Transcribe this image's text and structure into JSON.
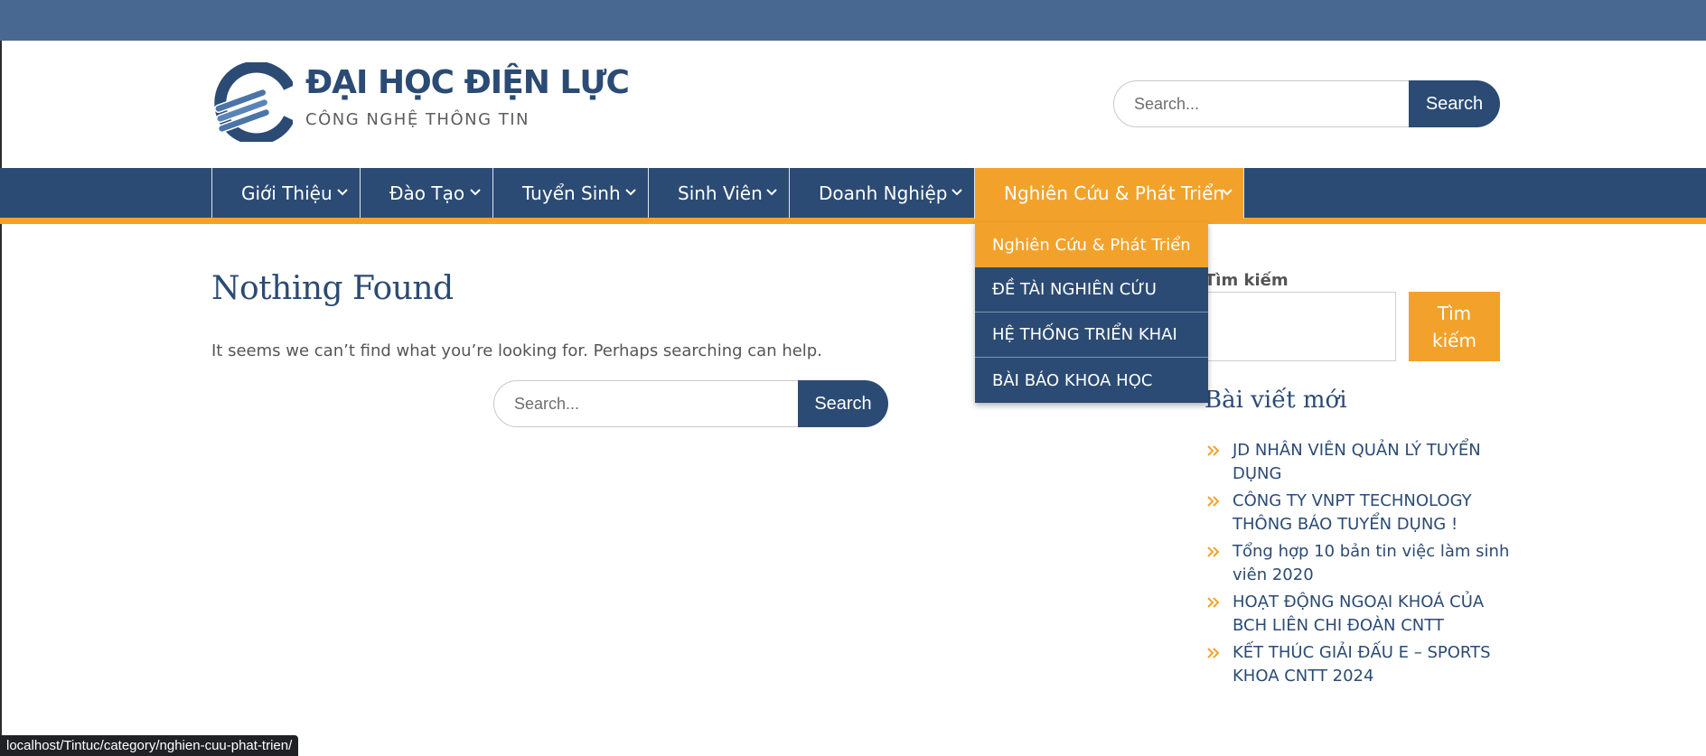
{
  "site": {
    "title": "ĐẠI HỌC ĐIỆN LỰC",
    "tagline": "CÔNG NGHỆ THÔNG TIN"
  },
  "header_search": {
    "placeholder": "Search...",
    "button": "Search"
  },
  "nav": {
    "items": [
      {
        "label": "Giới Thiệu"
      },
      {
        "label": "Đào Tạo"
      },
      {
        "label": "Tuyển Sinh"
      },
      {
        "label": "Sinh Viên"
      },
      {
        "label": "Doanh Nghiệp"
      },
      {
        "label": "Nghiên Cứu & Phát Triển",
        "active": true
      }
    ],
    "dropdown": [
      {
        "label": "Nghiên Cứu & Phát Triển"
      },
      {
        "label": "ĐỀ TÀI NGHIÊN CỨU"
      },
      {
        "label": "HỆ THỐNG TRIỂN KHAI"
      },
      {
        "label": "BÀI BÁO KHOA HỌC"
      }
    ]
  },
  "main": {
    "title": "Nothing Found",
    "message": "It seems we can’t find what you’re looking for. Perhaps searching can help.",
    "search": {
      "placeholder": "Search...",
      "button": "Search"
    }
  },
  "sidebar": {
    "search_label": "Tìm kiếm",
    "search_button": "Tìm kiếm",
    "recent_heading": "Bài viết mới",
    "recent_posts": [
      "JD NHÂN VIÊN QUẢN LÝ TUYỂN DỤNG",
      "CÔNG TY VNPT TECHNOLOGY THÔNG BÁO TUYỂN DỤNG !",
      "Tổng hợp 10 bản tin việc làm sinh viên 2020",
      "HOẠT ĐỘNG NGOẠI KHOÁ CỦA BCH LIÊN CHI ĐOÀN CNTT",
      "KẾT THÚC GIẢI ĐẤU E – SPORTS KHOA CNTT 2024"
    ]
  },
  "status_bar": {
    "url": "localhost/Tintuc/category/nghien-cuu-phat-trien/"
  },
  "colors": {
    "primary": "#2b4b74",
    "accent": "#f2a22b",
    "topbar": "#496891"
  },
  "icons": {
    "nav_caret": "chevron-down-icon",
    "list_bullet": "double-chevron-right-icon"
  }
}
